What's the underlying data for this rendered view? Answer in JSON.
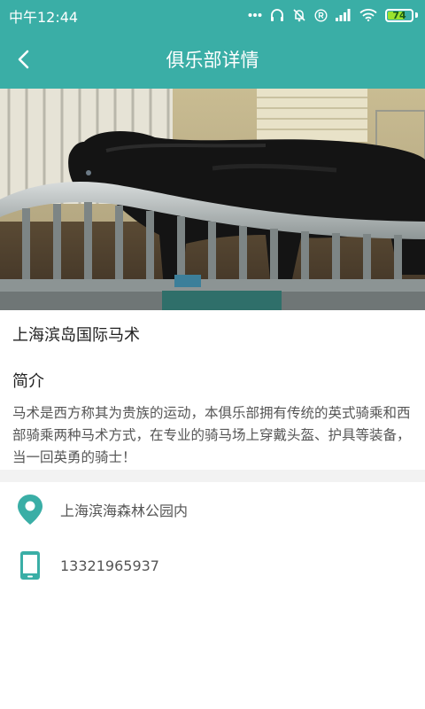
{
  "status_bar": {
    "time": "中午12:44",
    "battery": "74",
    "colors": {
      "background": "#3aaea6",
      "battery_fill": "#9be32d"
    },
    "icons": [
      "more-dots-icon",
      "headset-icon",
      "alarm-off-icon",
      "registered-icon",
      "signal-icon",
      "wifi-icon",
      "battery-icon"
    ]
  },
  "nav": {
    "title": "俱乐部详情",
    "back_icon": "chevron-left-icon",
    "background": "#3aaea6"
  },
  "hero": {
    "image_description": "black horse in stable stall"
  },
  "club": {
    "name": "上海滨岛国际马术",
    "intro_heading": "简介",
    "intro_text": "马术是西方称其为贵族的运动，本俱乐部拥有传统的英式骑乘和西部骑乘两种马术方式，在专业的骑马场上穿戴头盔、护具等装备，当一回英勇的骑士！"
  },
  "contact": {
    "address": "上海滨海森林公园内",
    "address_icon": "location-pin-icon",
    "phone": "13321965937",
    "phone_icon": "phone-icon",
    "icon_color": "#3aaea6"
  }
}
